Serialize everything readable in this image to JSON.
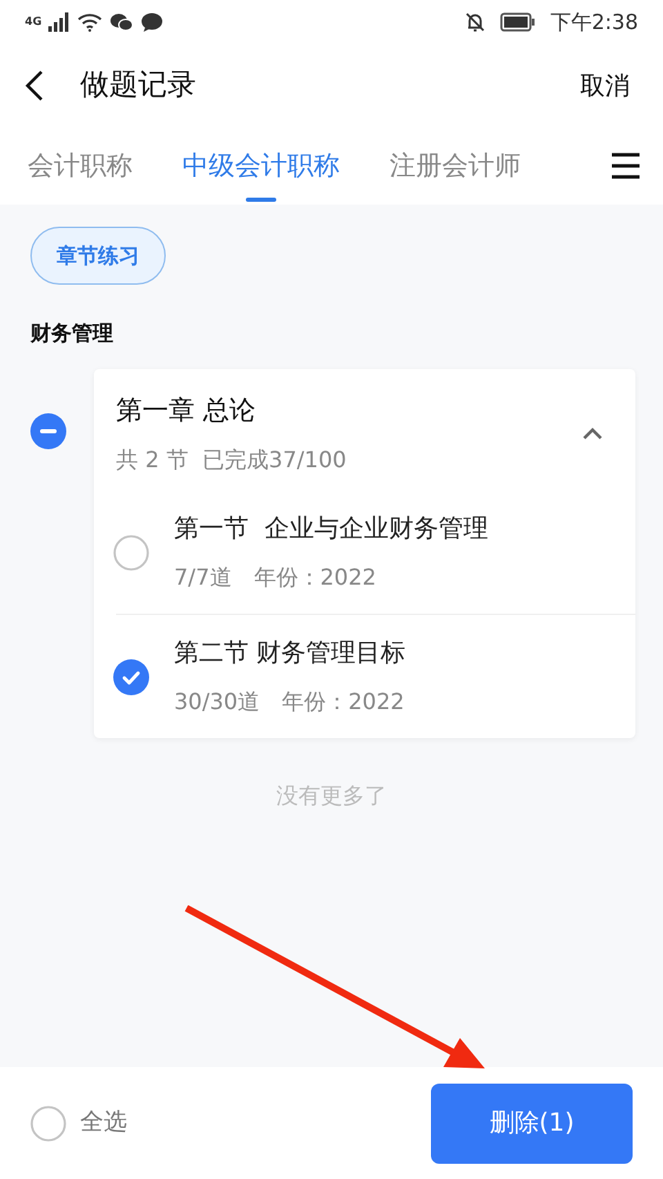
{
  "status_bar": {
    "network": "4G",
    "time": "下午2:38"
  },
  "header": {
    "title": "做题记录",
    "action": "取消"
  },
  "tabs": [
    {
      "label": "会计职称",
      "selected": false
    },
    {
      "label": "中级会计职称",
      "selected": true
    },
    {
      "label": "注册会计师",
      "selected": false
    }
  ],
  "filter_chip": {
    "label": "章节练习",
    "selected": true
  },
  "subject": "财务管理",
  "chapters": [
    {
      "title": "第一章 总论",
      "summary": "共 2 节  已完成37/100",
      "checked": false,
      "partial": true,
      "expanded": true,
      "sections": [
        {
          "title": "第一节  企业与企业财务管理",
          "count": "7/7道",
          "year": "年份：2022",
          "checked": false
        },
        {
          "title": "第二节 财务管理目标",
          "count": "30/30道",
          "year": "年份：2022",
          "checked": true
        }
      ]
    }
  ],
  "end_note": "没有更多了",
  "footer": {
    "select_all": {
      "label": "全选",
      "checked": false
    },
    "delete_button": "删除(1)"
  }
}
